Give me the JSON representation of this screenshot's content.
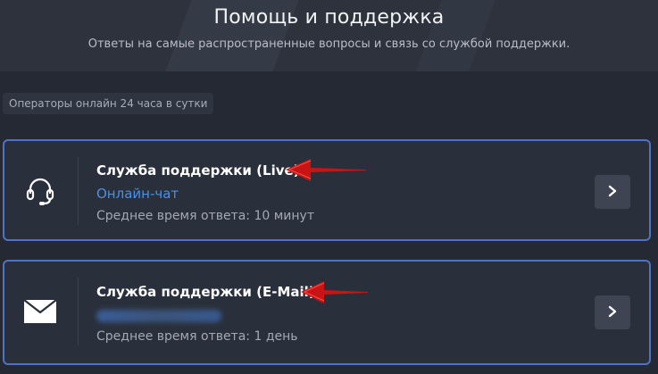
{
  "header": {
    "title": "Помощь и поддержка",
    "subtitle": "Ответы на самые распространенные вопросы и связь со службой поддержки."
  },
  "badge": "Операторы онлайн 24 часа в сутки",
  "cards": [
    {
      "id": "live",
      "icon": "headset-icon",
      "title": "Служба поддержки (Live)",
      "subtitle": "Онлайн-чат",
      "meta": "Среднее время ответа: 10 минут"
    },
    {
      "id": "email",
      "icon": "envelope-icon",
      "title": "Служба поддержки (E-Mail)",
      "subtitle": "",
      "meta": "Среднее время ответа: 1 день"
    }
  ],
  "colors": {
    "background": "#242934",
    "card_border": "#4f73c4",
    "link_blue": "#4a8fe8",
    "annotation_red": "#d21414"
  }
}
